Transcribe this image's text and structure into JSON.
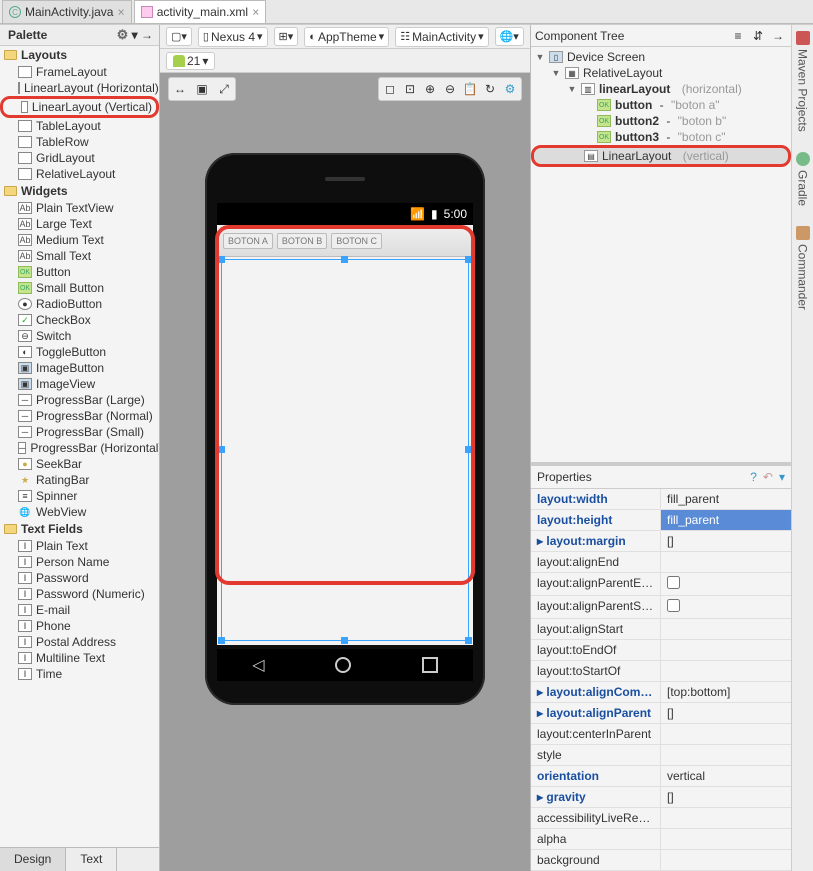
{
  "tabs": {
    "file1": "MainActivity.java",
    "file2": "activity_main.xml"
  },
  "palette": {
    "title": "Palette",
    "sections": {
      "layouts": "Layouts",
      "widgets": "Widgets",
      "textfields": "Text Fields"
    },
    "layouts": [
      "FrameLayout",
      "LinearLayout (Horizontal)",
      "LinearLayout (Vertical)",
      "TableLayout",
      "TableRow",
      "GridLayout",
      "RelativeLayout"
    ],
    "widgets": [
      "Plain TextView",
      "Large Text",
      "Medium Text",
      "Small Text",
      "Button",
      "Small Button",
      "RadioButton",
      "CheckBox",
      "Switch",
      "ToggleButton",
      "ImageButton",
      "ImageView",
      "ProgressBar (Large)",
      "ProgressBar (Normal)",
      "ProgressBar (Small)",
      "ProgressBar (Horizontal)",
      "SeekBar",
      "RatingBar",
      "Spinner",
      "WebView"
    ],
    "textfields": [
      "Plain Text",
      "Person Name",
      "Password",
      "Password (Numeric)",
      "E-mail",
      "Phone",
      "Postal Address",
      "Multiline Text",
      "Time"
    ]
  },
  "designerToolbar": {
    "device": "Nexus 4",
    "theme": "AppTheme",
    "activity": "MainActivity",
    "api": "21"
  },
  "phone": {
    "time": "5:00",
    "buttons": [
      "BOTON A",
      "BOTON B",
      "BOTON C"
    ]
  },
  "bottomTabs": {
    "design": "Design",
    "text": "Text"
  },
  "componentTree": {
    "title": "Component Tree",
    "root": "Device Screen",
    "relative": "RelativeLayout",
    "ll1": {
      "name": "linearLayout",
      "orient": "(horizontal)"
    },
    "btn1": {
      "name": "button",
      "sub": "\"boton a\""
    },
    "btn2": {
      "name": "button2",
      "sub": "\"boton b\""
    },
    "btn3": {
      "name": "button3",
      "sub": "\"boton c\""
    },
    "ll2": {
      "name": "LinearLayout",
      "orient": "(vertical)"
    }
  },
  "properties": {
    "title": "Properties",
    "rows": [
      {
        "k": "layout:width",
        "v": "fill_parent",
        "link": true
      },
      {
        "k": "layout:height",
        "v": "fill_parent",
        "link": true,
        "selected": true
      },
      {
        "k": "layout:margin",
        "v": "[]",
        "link": true,
        "expand": true
      },
      {
        "k": "layout:alignEnd",
        "v": ""
      },
      {
        "k": "layout:alignParentEnd",
        "v": "",
        "check": true
      },
      {
        "k": "layout:alignParentStart",
        "v": "",
        "check": true
      },
      {
        "k": "layout:alignStart",
        "v": ""
      },
      {
        "k": "layout:toEndOf",
        "v": ""
      },
      {
        "k": "layout:toStartOf",
        "v": ""
      },
      {
        "k": "layout:alignComponent",
        "v": "[top:bottom]",
        "link": true,
        "expand": true
      },
      {
        "k": "layout:alignParent",
        "v": "[]",
        "link": true,
        "expand": true
      },
      {
        "k": "layout:centerInParent",
        "v": ""
      },
      {
        "k": "style",
        "v": ""
      },
      {
        "k": "orientation",
        "v": "vertical",
        "link": true
      },
      {
        "k": "gravity",
        "v": "[]",
        "link": true,
        "expand": true
      },
      {
        "k": "accessibilityLiveRegion",
        "v": ""
      },
      {
        "k": "alpha",
        "v": ""
      },
      {
        "k": "background",
        "v": ""
      }
    ]
  },
  "gutter": {
    "maven": "Maven Projects",
    "gradle": "Gradle",
    "commander": "Commander"
  }
}
